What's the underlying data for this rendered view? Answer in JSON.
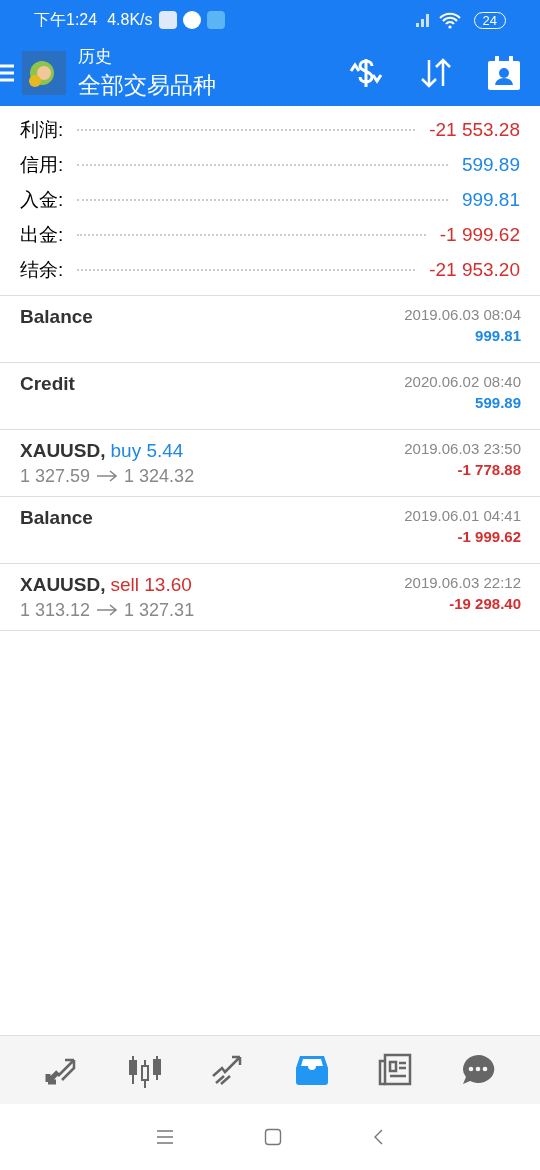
{
  "status_bar": {
    "time": "下午1:24",
    "speed": "4.8K/s",
    "battery": "24"
  },
  "header": {
    "title": "历史",
    "subtitle": "全部交易品种"
  },
  "summary": [
    {
      "label": "利润:",
      "value": "-21 553.28",
      "negative": true
    },
    {
      "label": "信用:",
      "value": "599.89",
      "negative": false
    },
    {
      "label": "入金:",
      "value": "999.81",
      "negative": false
    },
    {
      "label": "出金:",
      "value": "-1 999.62",
      "negative": true
    },
    {
      "label": "结余:",
      "value": "-21 953.20",
      "negative": true
    }
  ],
  "deals": [
    {
      "symbol": "Balance",
      "date": "2019.06.03 08:04",
      "amount": "999.81",
      "negative": false
    },
    {
      "symbol": "Credit",
      "date": "2020.06.02 08:40",
      "amount": "599.89",
      "negative": false
    },
    {
      "symbol": "XAUUSD,",
      "side": {
        "text": "buy 5.44",
        "kind": "buy"
      },
      "open": "1 327.59",
      "close": "1 324.32",
      "date": "2019.06.03 23:50",
      "amount": "-1 778.88",
      "negative": true
    },
    {
      "symbol": "Balance",
      "date": "2019.06.01 04:41",
      "amount": "-1 999.62",
      "negative": true
    },
    {
      "symbol": "XAUUSD,",
      "side": {
        "text": "sell 13.60",
        "kind": "sell"
      },
      "open": "1 313.12",
      "close": "1 327.31",
      "date": "2019.06.03 22:12",
      "amount": "-19 298.40",
      "negative": true
    }
  ],
  "nav": [
    {
      "kind": "trade",
      "selected": false
    },
    {
      "kind": "chart",
      "selected": false
    },
    {
      "kind": "trend",
      "selected": false
    },
    {
      "kind": "history",
      "selected": true
    },
    {
      "kind": "news",
      "selected": false
    },
    {
      "kind": "chat",
      "selected": false
    }
  ]
}
